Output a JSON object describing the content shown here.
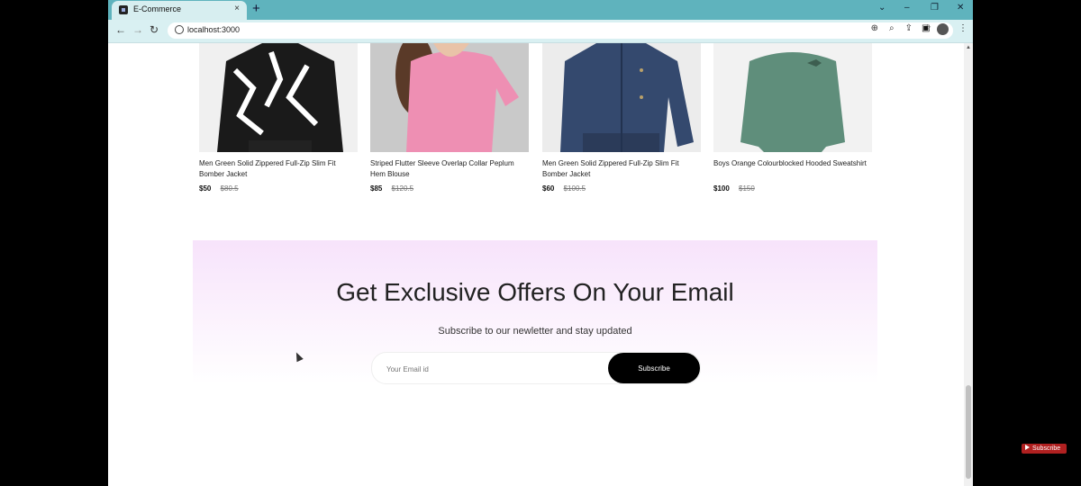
{
  "browser": {
    "tab_title": "E-Commerce",
    "url": "localhost:3000",
    "new_tab_symbol": "+",
    "close_symbol": "×"
  },
  "products": [
    {
      "name": "Men Green Solid Zippered Full-Zip Slim Fit Bomber Jacket",
      "new_price": "$50",
      "old_price": "$80.5"
    },
    {
      "name": "Striped Flutter Sleeve Overlap Collar Peplum Hem Blouse",
      "new_price": "$85",
      "old_price": "$120.5"
    },
    {
      "name": "Men Green Solid Zippered Full-Zip Slim Fit Bomber Jacket",
      "new_price": "$60",
      "old_price": "$100.5"
    },
    {
      "name": "Boys Orange Colourblocked Hooded Sweatshirt",
      "new_price": "$100",
      "old_price": "$150"
    }
  ],
  "newsletter": {
    "heading": "Get Exclusive Offers On Your Email",
    "subtitle": "Subscribe to our newletter and stay updated",
    "email_placeholder": "Your Email id",
    "button_label": "Subscribe"
  },
  "overlay": {
    "yt_label": "Subscribe"
  },
  "colors": {
    "tab_bar": "#5fb3bd",
    "toolbar": "#d9f0f2",
    "newsletter_gradient_top": "#f7e3fb",
    "button": "#000000"
  }
}
